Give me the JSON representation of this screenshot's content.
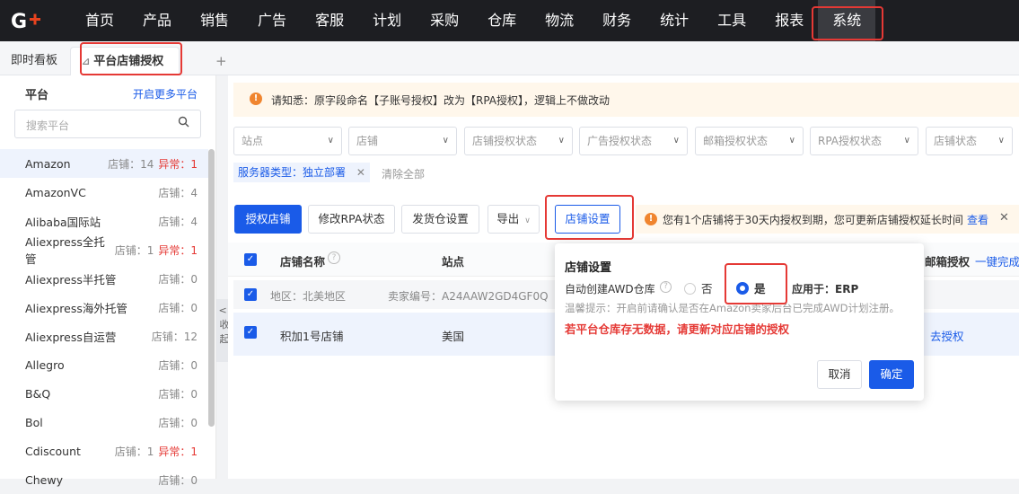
{
  "nav": {
    "items": [
      "首页",
      "产品",
      "销售",
      "广告",
      "客服",
      "计划",
      "采购",
      "仓库",
      "物流",
      "财务",
      "统计",
      "工具",
      "报表",
      "系统"
    ]
  },
  "tabs": {
    "dashboard": "即时看板",
    "active": "平台店铺授权",
    "add": "+"
  },
  "sidebar": {
    "title": "平台",
    "more_link": "开启更多平台",
    "search_placeholder": "搜索平台",
    "collapse_label": "收起",
    "collapse_arrow": "<|",
    "items": [
      {
        "name": "Amazon",
        "count": "店铺：14",
        "abnormal": "异常：1"
      },
      {
        "name": "AmazonVC",
        "count": "店铺：4",
        "abnormal": ""
      },
      {
        "name": "Alibaba国际站",
        "count": "店铺：4",
        "abnormal": ""
      },
      {
        "name": "Aliexpress全托管",
        "count": "店铺：1",
        "abnormal": "异常：1"
      },
      {
        "name": "Aliexpress半托管",
        "count": "店铺：0",
        "abnormal": ""
      },
      {
        "name": "Aliexpress海外托管",
        "count": "店铺：0",
        "abnormal": ""
      },
      {
        "name": "Aliexpress自运营",
        "count": "店铺：12",
        "abnormal": ""
      },
      {
        "name": "Allegro",
        "count": "店铺：0",
        "abnormal": ""
      },
      {
        "name": "B&Q",
        "count": "店铺：0",
        "abnormal": ""
      },
      {
        "name": "Bol",
        "count": "店铺：0",
        "abnormal": ""
      },
      {
        "name": "Cdiscount",
        "count": "店铺：1",
        "abnormal": "异常：1"
      },
      {
        "name": "Chewy",
        "count": "店铺：0",
        "abnormal": ""
      }
    ]
  },
  "notice": {
    "text": "请知悉：原字段命名【子账号授权】改为【RPA授权】，逻辑上不做改动"
  },
  "filters": [
    "站点",
    "店铺",
    "店铺授权状态",
    "广告授权状态",
    "邮箱授权状态",
    "RPA授权状态",
    "店铺状态"
  ],
  "active_filter": {
    "label": "服务器类型：独立部署",
    "clear": "清除全部"
  },
  "toolbar": {
    "authorize": "授权店铺",
    "modify_rpa": "修改RPA状态",
    "ship_warehouse": "发货仓设置",
    "export": "导出",
    "store_settings": "店铺设置",
    "expire_warning": "您有1个店铺将于30天内授权到期，您可更新店铺授权延长时间",
    "view_link": "查看"
  },
  "table": {
    "headers": {
      "store_name": "店铺名称",
      "site": "站点",
      "email_auth": "邮箱授权",
      "one_click": "一键完成"
    },
    "group": {
      "region": "地区：北美地区",
      "seller": "卖家编号：A24AAW2GD4GF0Q"
    },
    "row": {
      "name": "积加1号店铺",
      "site": "美国",
      "action": "去授权"
    }
  },
  "popup": {
    "title": "店铺设置",
    "awd_label": "自动创建AWD仓库",
    "option_no": "否",
    "option_yes": "是",
    "apply_to": "应用于：ERP",
    "tip": "温馨提示：开启前请确认是否在Amazon卖家后台已完成AWD计划注册。",
    "warning": "若平台仓库存无数据，请更新对应店铺的授权",
    "cancel": "取消",
    "confirm": "确定",
    "selected": "是"
  },
  "colors": {
    "primary": "#1a5be8",
    "nav_bg": "#1d1e22",
    "highlight": "#e53935",
    "notice_bg": "#fff7eb"
  }
}
